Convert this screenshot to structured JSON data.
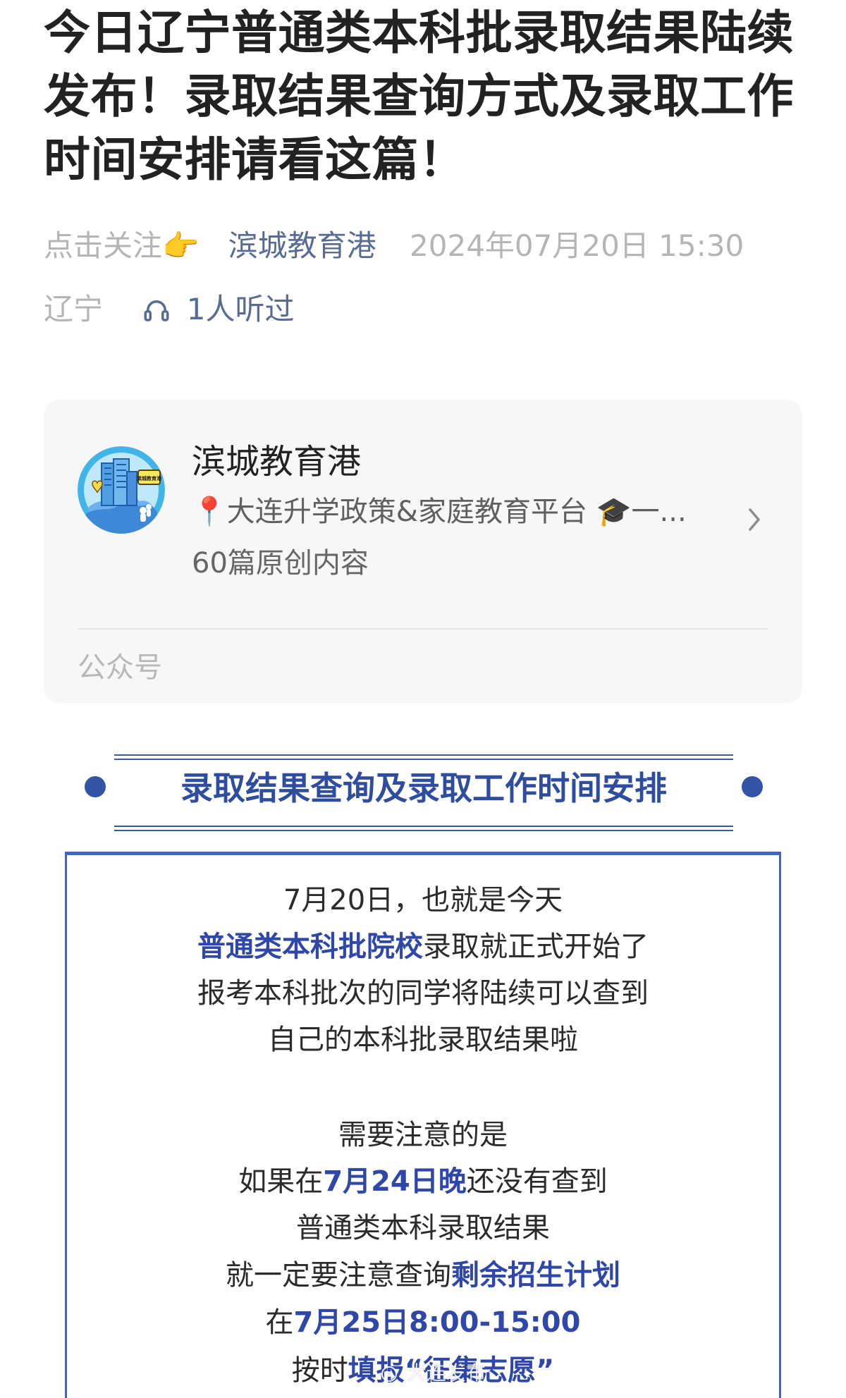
{
  "article": {
    "title": "今日辽宁普通类本科批录取结果陆续发布！录取结果查询方式及录取工作时间安排请看这篇！",
    "follow_prompt": "点击关注👉",
    "account_name": "滨城教育港",
    "publish_time": "2024年07月20日 15:30",
    "location": "辽宁",
    "listen_count": "1人听过",
    "listen_icon": "headphones-icon"
  },
  "account_card": {
    "name": "滨城教育港",
    "description": "📍大连升学政策&家庭教育平台 🎓一...",
    "article_count": "60篇原创内容",
    "type_label": "公众号",
    "avatar_badge": "滨城教育港",
    "chevron_icon": "chevron-right-icon"
  },
  "section": {
    "heading": "录取结果查询及录取工作时间安排"
  },
  "notice": {
    "line1": "7月20日，也就是今天",
    "line2_highlight": "普通类本科批院校",
    "line2_rest": "录取就正式开始了",
    "line3": "报考本科批次的同学将陆续可以查到",
    "line4": "自己的本科批录取结果啦",
    "line5": "需要注意的是",
    "line6_prefix": "如果在",
    "line6_highlight": "7月24日晚",
    "line6_suffix": "还没有查到",
    "line7": "普通类本科录取结果",
    "line8_prefix": "就一定要注意查询",
    "line8_highlight": "剩余招生计划",
    "line9_prefix": "在",
    "line9_highlight": "7月25日8:00-15:00",
    "line10_prefix": "按时",
    "line10_highlight": "填报“征集志愿”"
  },
  "watermark": {
    "text": "大连发布"
  },
  "colors": {
    "link": "#576b95",
    "accent": "#2f4d9f",
    "border": "#4466b4",
    "muted": "#b5b5b5",
    "card_background": "#f7f7f7"
  }
}
